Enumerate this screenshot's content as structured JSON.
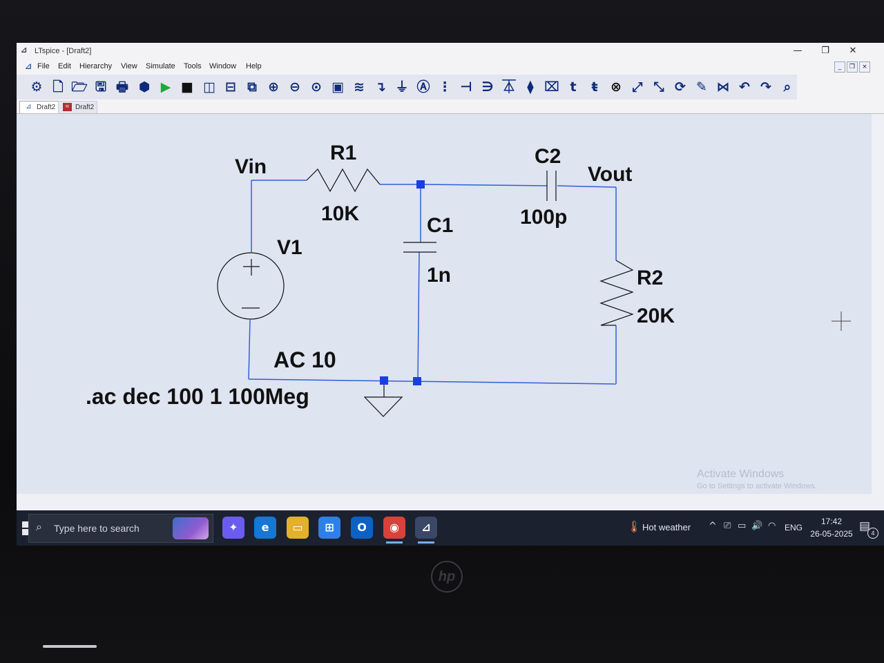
{
  "window": {
    "title": "LTspice - [Draft2]",
    "minimize_glyph": "—",
    "maximize_glyph": "❐",
    "close_glyph": "✕"
  },
  "menu": {
    "items": [
      "File",
      "Edit",
      "Hierarchy",
      "View",
      "Simulate",
      "Tools",
      "Window",
      "Help"
    ]
  },
  "toolbar": {
    "icons": [
      {
        "name": "control-panel-icon",
        "glyph": "⚙"
      },
      {
        "name": "new-schematic-icon",
        "glyph": "🗋"
      },
      {
        "name": "open-icon",
        "glyph": "🗁"
      },
      {
        "name": "save-icon",
        "glyph": "🖫"
      },
      {
        "name": "print-icon",
        "glyph": "🖶"
      },
      {
        "name": "ac-analysis-icon",
        "glyph": "⬢"
      },
      {
        "name": "run-icon",
        "glyph": "▶"
      },
      {
        "name": "halt-icon",
        "glyph": "■"
      },
      {
        "name": "tile-vertical-icon",
        "glyph": "◫"
      },
      {
        "name": "tile-horizontal-icon",
        "glyph": "⊟"
      },
      {
        "name": "cascade-windows-icon",
        "glyph": "⧉"
      },
      {
        "name": "zoom-in-icon",
        "glyph": "⊕"
      },
      {
        "name": "zoom-out-icon",
        "glyph": "⊖"
      },
      {
        "name": "zoom-fit-icon",
        "glyph": "⊙"
      },
      {
        "name": "autorange-icon",
        "glyph": "▣"
      },
      {
        "name": "waveform-icon",
        "glyph": "≋"
      },
      {
        "name": "wire-icon",
        "glyph": "↴"
      },
      {
        "name": "ground-icon",
        "glyph": "⏚"
      },
      {
        "name": "label-net-icon",
        "glyph": "Ⓐ"
      },
      {
        "name": "resistor-icon",
        "glyph": "⋮"
      },
      {
        "name": "capacitor-icon",
        "glyph": "⊣"
      },
      {
        "name": "inductor-icon",
        "glyph": "∋"
      },
      {
        "name": "diode-icon",
        "glyph": "⏄"
      },
      {
        "name": "component-icon",
        "glyph": "⧫"
      },
      {
        "name": "net-label-icon",
        "glyph": "⌧"
      },
      {
        "name": "text-icon",
        "glyph": "t"
      },
      {
        "name": "spice-directive-icon",
        "glyph": "ŧ"
      },
      {
        "name": "delete-icon",
        "glyph": "⊗"
      },
      {
        "name": "move-icon",
        "glyph": "⤢"
      },
      {
        "name": "drag-icon",
        "glyph": "⤡"
      },
      {
        "name": "rotate-icon",
        "glyph": "⟳"
      },
      {
        "name": "edit-icon",
        "glyph": "✎"
      },
      {
        "name": "mirror-icon",
        "glyph": "⋈"
      },
      {
        "name": "undo-icon",
        "glyph": "↶"
      },
      {
        "name": "redo-icon",
        "glyph": "↷"
      },
      {
        "name": "find-icon",
        "glyph": "⌕"
      }
    ]
  },
  "tabs": [
    {
      "label": "Draft2"
    },
    {
      "label": "Draft2"
    }
  ],
  "schematic": {
    "labels": {
      "vin": "Vin",
      "vout": "Vout",
      "r1_name": "R1",
      "r1_value": "10K",
      "c1_name": "C1",
      "c1_value": "1n",
      "c2_name": "C2",
      "c2_value": "100p",
      "r2_name": "R2",
      "r2_value": "20K",
      "v1_name": "V1",
      "v1_value": "AC 10",
      "directive": ".ac dec 100 1 100Meg"
    },
    "wire_color": "#2f5fd8",
    "junction_color": "#1a3fe0"
  },
  "watermark": {
    "title": "Activate Windows",
    "subtitle": "Go to Settings to activate Windows."
  },
  "taskbar": {
    "search_placeholder": "Type here to search",
    "apps": [
      {
        "name": "copilot-icon",
        "glyph": "✦",
        "color": "#6a5cf0"
      },
      {
        "name": "edge-icon",
        "glyph": "e",
        "color": "#1577d6"
      },
      {
        "name": "file-explorer-icon",
        "glyph": "▭",
        "color": "#e4b12c"
      },
      {
        "name": "microsoft-store-icon",
        "glyph": "⊞",
        "color": "#2f7fe8"
      },
      {
        "name": "outlook-icon",
        "glyph": "O",
        "color": "#0b62c4"
      },
      {
        "name": "chrome-icon",
        "glyph": "◉",
        "color": "#d9413a"
      },
      {
        "name": "ltspice-icon",
        "glyph": "⊿",
        "color": "#3a4766"
      }
    ],
    "weather": "Hot weather",
    "language": "ENG",
    "time": "17:42",
    "date": "26-05-2025",
    "notifications": "4"
  }
}
